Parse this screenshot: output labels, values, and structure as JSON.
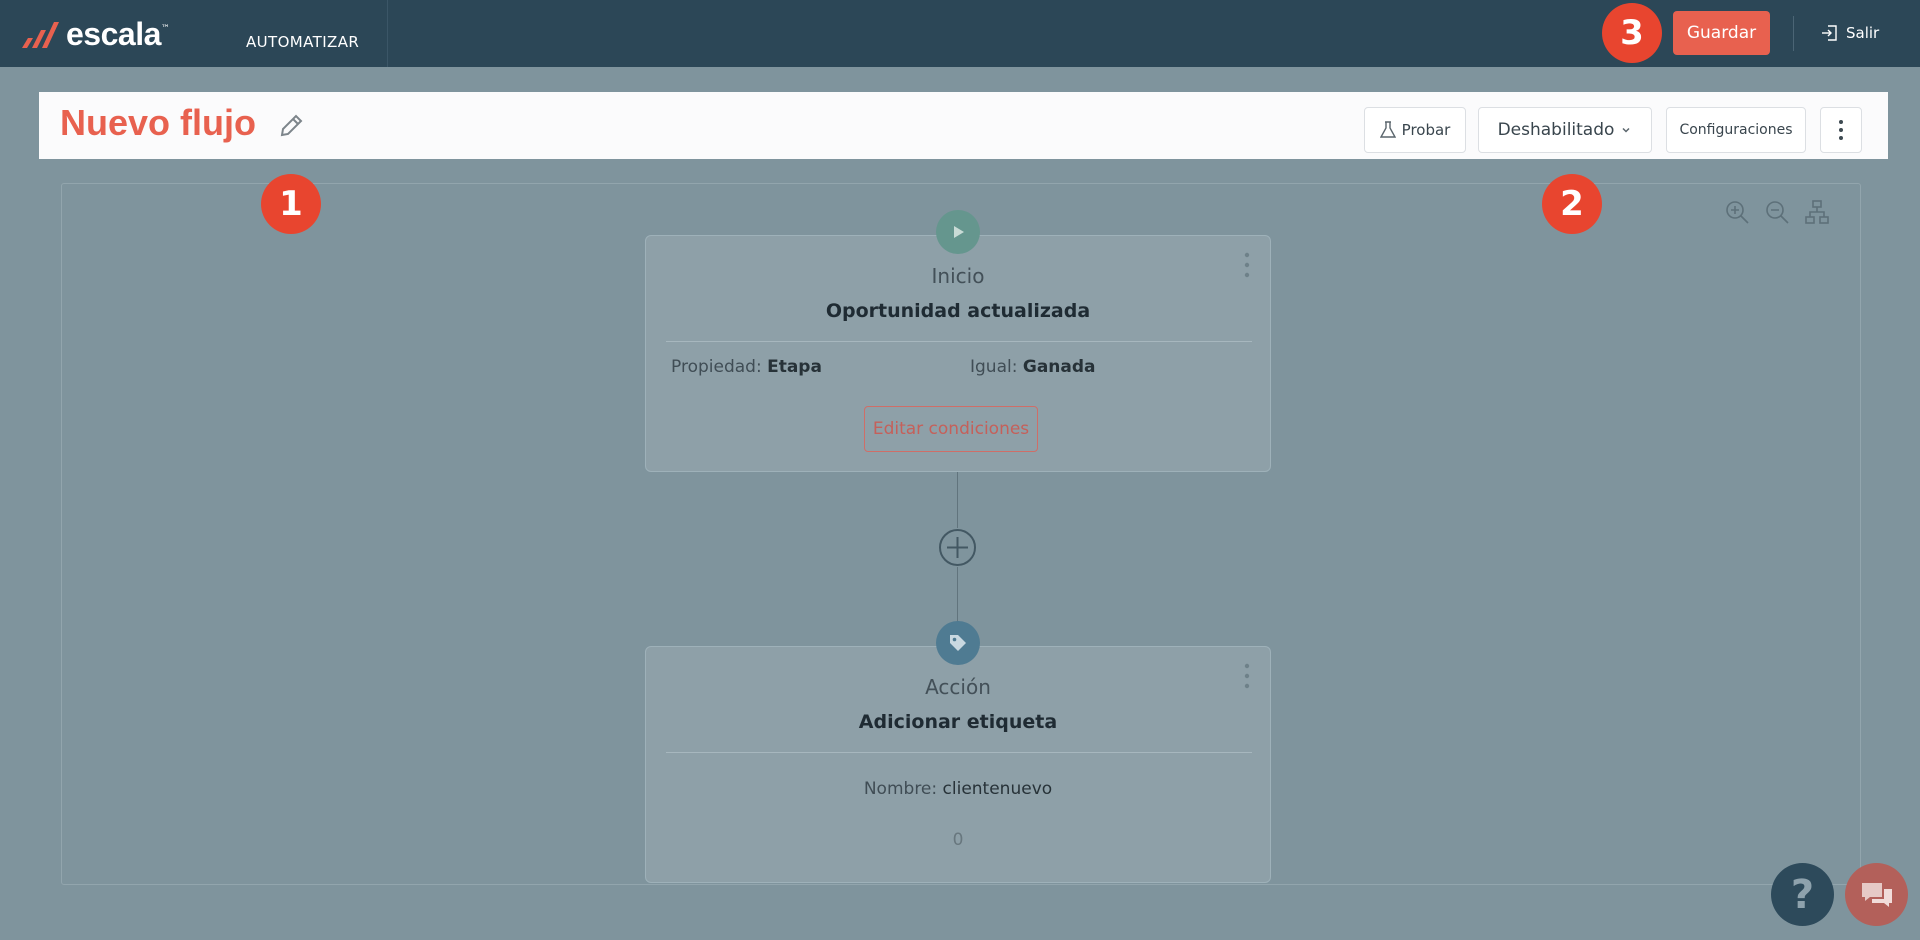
{
  "app": {
    "logo_text": "escala",
    "logo_tm": "™",
    "nav_label": "AUTOMATIZAR",
    "save_label": "Guardar",
    "exit_label": "Salir"
  },
  "flow": {
    "title": "Nuevo flujo",
    "test_label": "Probar",
    "status_label": "Deshabilitado",
    "settings_label": "Configuraciones"
  },
  "nodes": {
    "start": {
      "kind": "Inicio",
      "title": "Oportunidad actualizada",
      "property_key": "Propiedad:",
      "property_value": "Etapa",
      "operator_key": "Igual:",
      "operator_value": "Ganada",
      "edit_label": "Editar condiciones"
    },
    "action": {
      "kind": "Acción",
      "title": "Adicionar etiqueta",
      "name_key": "Nombre:",
      "name_value": "clientenuevo",
      "count": "0"
    }
  },
  "tour": {
    "step1": "1",
    "step2": "2",
    "step3": "3"
  },
  "widgets": {
    "help_label": "?"
  },
  "icons": {
    "edit": "pencil-icon",
    "test": "flask-icon",
    "status": "chevron-down-icon",
    "more": "vertical-dots-icon",
    "exit": "exit-icon",
    "zoom_in": "zoom-in-icon",
    "zoom_out": "zoom-out-icon",
    "layout": "hierarchy-icon",
    "start": "play-icon",
    "action": "tag-icon",
    "add": "plus-circle-icon",
    "chat": "chat-icon"
  },
  "colors": {
    "brand": "#e8614f",
    "topbar": "#2c4757"
  }
}
